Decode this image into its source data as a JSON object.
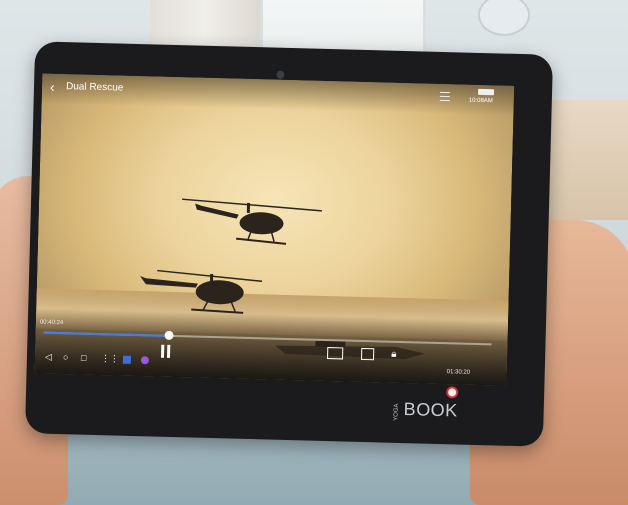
{
  "video": {
    "title": "Dual Rescue",
    "elapsed": "00:40:24",
    "duration": "01:30:20",
    "clock": "10:08AM",
    "progress_fraction": 0.28
  },
  "icons": {
    "back": "back-arrow-icon",
    "menu": "menu-icon",
    "battery": "battery-icon",
    "pause": "pause-icon",
    "pip": "picture-in-picture-icon",
    "fit": "aspect-ratio-icon",
    "lock": "lock-icon",
    "nav_back": "back-triangle-icon",
    "nav_home": "home-circle-icon",
    "nav_recent": "recent-apps-icon",
    "nav_grid": "app-grid-icon"
  },
  "device": {
    "brand_small": "YOGA",
    "brand_large": "BOOK"
  },
  "nav": {
    "back": "◁",
    "home": "○",
    "recent": "□",
    "grid": "⋮⋮"
  }
}
